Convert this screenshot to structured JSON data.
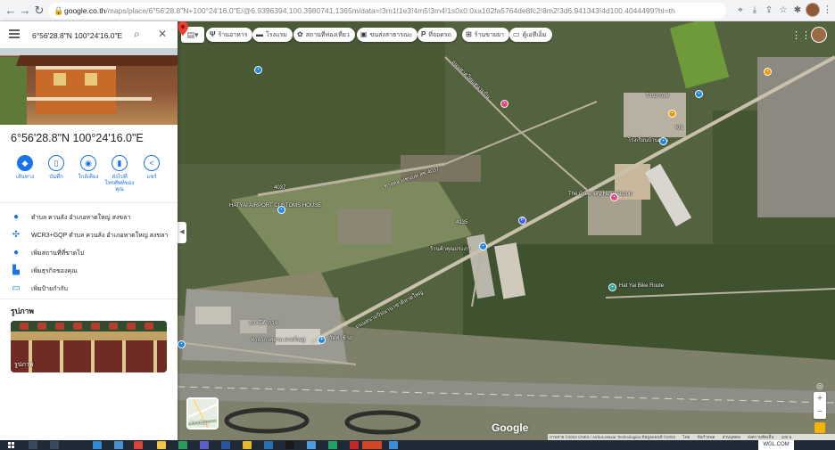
{
  "browser": {
    "url_host": "google.co.th",
    "url_path": "/maps/place/6°56'28.8\"N+100°24'16.0\"E/@6.9396394,100.3980741,1365m/data=!3m1!1e3!4m5!3m4!1s0x0:0xa162fa5764de8fc2!8m2!3d6.941343!4d100.4044499?hl=th",
    "back_icon": "arrow-left-icon",
    "forward_icon": "arrow-right-icon",
    "reload_icon": "reload-icon",
    "lock_icon": "lock-icon"
  },
  "panel": {
    "search_value": "6°56'28.8\"N 100°24'16.0\"E",
    "place_title": "6°56'28.8\"N 100°24'16.0\"E",
    "actions": [
      {
        "label": "เส้นทาง",
        "icon": "directions-icon"
      },
      {
        "label": "บันทึก",
        "icon": "bookmark-icon"
      },
      {
        "label": "ใกล้เคียง",
        "icon": "nearby-icon"
      },
      {
        "label": "ส่งไปที่โทรศัพท์ของคุณ",
        "icon": "phone-icon"
      },
      {
        "label": "แชร์",
        "icon": "share-icon"
      }
    ],
    "info": [
      {
        "text": "ตำบล ควนลัง อำเภอหาดใหญ่ สงขลา",
        "icon": "location-pin-icon"
      },
      {
        "text": "WCR3+GQP ตำบล ควนลัง อำเภอหาดใหญ่ สงขลา",
        "icon": "plus-code-icon"
      },
      {
        "text": "เพิ่มสถานที่ที่ขาดไป",
        "icon": "add-place-icon"
      },
      {
        "text": "เพิ่มธุรกิจของคุณ",
        "icon": "store-icon"
      },
      {
        "text": "เพิ่มป้ายกำกับ",
        "icon": "label-icon"
      }
    ],
    "photos_heading": "รูปภาพ",
    "photo_caption": "รูปภาพ"
  },
  "map": {
    "layers_toggle_icon": "layers-icon",
    "chips": [
      {
        "label": "ร้านอาหาร",
        "icon": "restaurant-icon"
      },
      {
        "label": "โรงแรม",
        "icon": "hotel-icon"
      },
      {
        "label": "สถานที่ท่องเที่ยว",
        "icon": "attraction-icon"
      },
      {
        "label": "ขนส่งสาธารณะ",
        "icon": "transit-icon"
      },
      {
        "label": "ที่จอดรถ",
        "icon": "parking-icon"
      },
      {
        "label": "ร้านขายยา",
        "icon": "pharmacy-icon"
      },
      {
        "label": "ตู้เอทีเอ็ม",
        "icon": "atm-icon"
      }
    ],
    "labels": {
      "customs": "HATYAI AIRPORT CUSTOMS HOUSE",
      "hotel": "The Greenery Hotel Airport",
      "road_4037": "ทางหลวงชนบท สข.4037",
      "road_4037_b": "4037",
      "road_4135": "4135",
      "bike": "Hat Yai Bike Route",
      "road_airport": "ถนนสนามบินนานาชาติหาดใหญ่",
      "road_north": "ถนนหาดใหญ่สนามบิน",
      "cafe": "ร้านกาแฟ",
      "shop": "ร้านค้าคุณประภา",
      "school": "โรงเรียนบ้านดอน",
      "station": "สถานีตำรวจ",
      "airport": "ท่าอากาศยาน หาดใหญ่",
      "temple": "วัดท่าช้าง",
      "kn": "KN"
    },
    "minimap_label": "ดาวเทียม",
    "google_logo": "Google",
    "footer": {
      "imagery": "ภาพถ่าย ©2022 CNES / Airbus,Maxar Technologies,ข้อมูลแผนที่ ©2022",
      "thailand": "ไทย",
      "terms": "ข้อกำหนด",
      "privacy": "ส่วนบุคคล",
      "feedback": "ส่งความคิดเห็น",
      "scale": "100 ม."
    }
  },
  "taskbar": {
    "tray_text": "WGL.COM"
  },
  "colors": {
    "accent": "#1a73e8",
    "pin": "#ea4335"
  }
}
